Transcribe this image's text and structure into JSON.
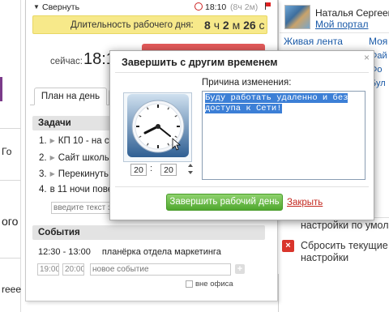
{
  "background": {
    "left_frags": [
      "Го",
      "ого",
      "reee"
    ],
    "user": {
      "name": "Наталья Сергеев",
      "portal_link": "Мой портал"
    },
    "nav": {
      "live_feed": "Живая лента",
      "second_frag": "Моя"
    },
    "right_frags": [
      "Фай",
      "Фо",
      "Бул"
    ],
    "settings": {
      "defaults_label": "настройки по умолч",
      "reset_label": "Сбросить текущие настройки"
    }
  },
  "workday": {
    "collapse_label": "Свернуть",
    "clock_time": "18:10",
    "clock_elapsed": "(8ч 2м)",
    "duration_label": "Длительность рабочего дня:",
    "duration": {
      "h": "8",
      "h_unit": "ч",
      "m": "2",
      "m_unit": "м",
      "s": "26",
      "s_unit": "с"
    },
    "now_label": "сейчас:",
    "now_time": "18:1",
    "tabs": {
      "plan": "План на день"
    },
    "tasks_head": "Задачи",
    "tasks": [
      {
        "num": "1.",
        "text": "КП 10 - на сут"
      },
      {
        "num": "2.",
        "text": "Сайт школы -"
      },
      {
        "num": "3.",
        "text": "Перекинуть д"
      },
      {
        "num": "4.",
        "text": "в 11 ночи повес"
      }
    ],
    "task_placeholder": "введите текст з",
    "events_head": "События",
    "events": [
      {
        "time": "12:30 - 13:00",
        "title": "планёрка отдела маркетинга"
      }
    ],
    "new_event": {
      "from": "19:00",
      "to": "20:00",
      "placeholder": "новое событие"
    },
    "outside_office": "вне офиса"
  },
  "modal": {
    "title": "Завершить с другим временем",
    "close_symbol": "×",
    "reason_label": "Причина изменения:",
    "reason_text": "Буду работать удаленно и без доступа к Сети!",
    "hours": "20",
    "minutes": "20",
    "finish_button": "Завершить рабочий день",
    "close_link": "Закрыть"
  },
  "icons": {
    "collapse": "triangle-down-icon",
    "clock": "clock-icon",
    "flag": "flag-icon",
    "reset": "close-icon",
    "add": "plus-icon",
    "analog_clock": "analog-clock-icon"
  },
  "colors": {
    "duration_bar": "#f7e98a",
    "finish_button": "#4fa72e",
    "close_link": "#c4281f",
    "selection": "#3c7fd6",
    "link": "#1a5aa8"
  }
}
